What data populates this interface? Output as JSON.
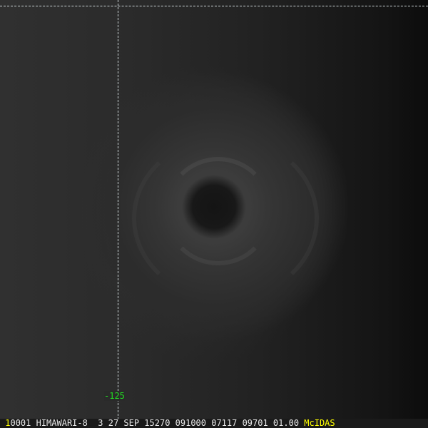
{
  "image": {
    "type": "satellite-imagery",
    "subject": "typhoon"
  },
  "overlay": {
    "longitude_label": "-125"
  },
  "status_bar": {
    "frame": "1",
    "text": "0001 HIMAWARI-8  3 27 SEP 15270 091000 07117 09701 01.00",
    "brand": "McIDAS"
  },
  "colors": {
    "overlay_line": "#cfd8da",
    "label_green": "#22dd22",
    "brand_yellow": "#ffff00"
  }
}
